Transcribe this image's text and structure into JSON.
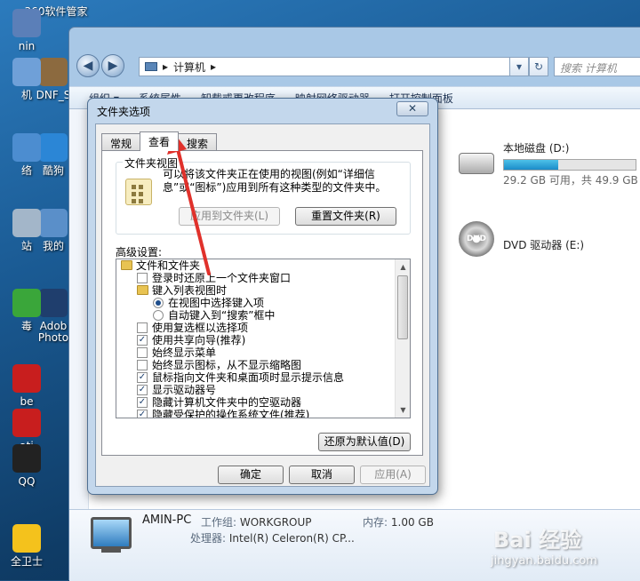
{
  "desktop": {
    "icons": [
      {
        "label": "360软件管家",
        "name": "desktop-icon-360-software-manager",
        "color": "#37a447"
      },
      {
        "label": "nin",
        "name": "desktop-icon-admin-cut",
        "color": "#5b7fb8"
      },
      {
        "label": "DNF_S",
        "name": "desktop-icon-dnf",
        "color": "#8c6a3f"
      },
      {
        "label": "机",
        "name": "desktop-icon-computer-cut",
        "color": "#6fa0d8"
      },
      {
        "label": "酷狗",
        "name": "desktop-icon-kugou",
        "color": "#2b86d6"
      },
      {
        "label": "络",
        "name": "desktop-icon-network-cut",
        "color": "#4c8dd0"
      },
      {
        "label": "我的",
        "name": "desktop-icon-mine-cut",
        "color": "#5a8fc9"
      },
      {
        "label": "站",
        "name": "desktop-icon-recycle-cut",
        "color": "#a3b6c9"
      },
      {
        "label": "Adob",
        "name": "desktop-icon-adobe-photoshop",
        "color": "#1f3e6d"
      },
      {
        "label": "Photo",
        "name": "desktop-icon-adobe-photoshop-label2",
        "color": "#1f3e6d"
      },
      {
        "label": "毒",
        "name": "desktop-icon-antivirus-cut",
        "color": "#3aa63a"
      },
      {
        "label": "be",
        "name": "desktop-icon-adobe-reader-cut",
        "color": "#c81e1e"
      },
      {
        "label": "ati",
        "name": "desktop-icon-adobe-reader-cut2",
        "color": "#c81e1e"
      },
      {
        "label": "QQ",
        "name": "desktop-icon-qq",
        "color": "#222222"
      },
      {
        "label": "全卫士",
        "name": "desktop-icon-360-safe",
        "color": "#f4c21c"
      }
    ]
  },
  "explorer": {
    "breadcrumb": "计算机",
    "search_placeholder": "搜索 计算机",
    "toolbar": [
      "组织 ▾",
      "系统属性",
      "卸载或更改程序",
      "映射网络驱动器",
      "打开控制面板"
    ],
    "drives": {
      "d": {
        "name": "本地磁盘 (D:)",
        "free_text": "29.2 GB 可用，共 49.9 GB",
        "used_fraction": 0.415
      },
      "e": {
        "name": "DVD 驱动器 (E:)",
        "disc_label": "DVD"
      }
    },
    "details": {
      "pc_name": "AMIN-PC",
      "workgroup_label": "工作组:",
      "workgroup_value": "WORKGROUP",
      "memory_label": "内存:",
      "memory_value": "1.00 GB",
      "cpu_label": "处理器:",
      "cpu_value": "Intel(R) Celeron(R) CP..."
    }
  },
  "dialog": {
    "title": "文件夹选项",
    "close_glyph": "✕",
    "tabs": [
      "常规",
      "查看",
      "搜索"
    ],
    "active_tab": 1,
    "folder_view": {
      "legend": "文件夹视图",
      "description": "可以将该文件夹正在使用的视图(例如“详细信息”或“图标”)应用到所有这种类型的文件夹中。",
      "apply_button": "应用到文件夹(L)",
      "reset_button": "重置文件夹(R)"
    },
    "advanced_label": "高级设置:",
    "tree": [
      {
        "type": "folder",
        "indent": 0,
        "label": "文件和文件夹"
      },
      {
        "type": "checkbox",
        "indent": 1,
        "checked": false,
        "label": "登录时还原上一个文件夹窗口"
      },
      {
        "type": "folder",
        "indent": 1,
        "label": "键入列表视图时"
      },
      {
        "type": "radio",
        "indent": 2,
        "checked": true,
        "label": "在视图中选择键入项"
      },
      {
        "type": "radio",
        "indent": 2,
        "checked": false,
        "label": "自动键入到“搜索”框中"
      },
      {
        "type": "checkbox",
        "indent": 1,
        "checked": false,
        "label": "使用复选框以选择项"
      },
      {
        "type": "checkbox",
        "indent": 1,
        "checked": true,
        "label": "使用共享向导(推荐)"
      },
      {
        "type": "checkbox",
        "indent": 1,
        "checked": false,
        "label": "始终显示菜单"
      },
      {
        "type": "checkbox",
        "indent": 1,
        "checked": false,
        "label": "始终显示图标，从不显示缩略图"
      },
      {
        "type": "checkbox",
        "indent": 1,
        "checked": true,
        "label": "鼠标指向文件夹和桌面项时显示提示信息"
      },
      {
        "type": "checkbox",
        "indent": 1,
        "checked": true,
        "label": "显示驱动器号"
      },
      {
        "type": "checkbox",
        "indent": 1,
        "checked": true,
        "label": "隐藏计算机文件夹中的空驱动器"
      },
      {
        "type": "checkbox",
        "indent": 1,
        "checked": true,
        "label": "隐藏受保护的操作系统文件(推荐)"
      }
    ],
    "restore_defaults_button": "还原为默认值(D)",
    "ok_button": "确定",
    "cancel_button": "取消",
    "apply_button": "应用(A)"
  },
  "watermark": {
    "brand": "Bai 经验",
    "url": "jingyan.baidu.com"
  },
  "colors": {
    "annotation_arrow": "#e0312b"
  }
}
